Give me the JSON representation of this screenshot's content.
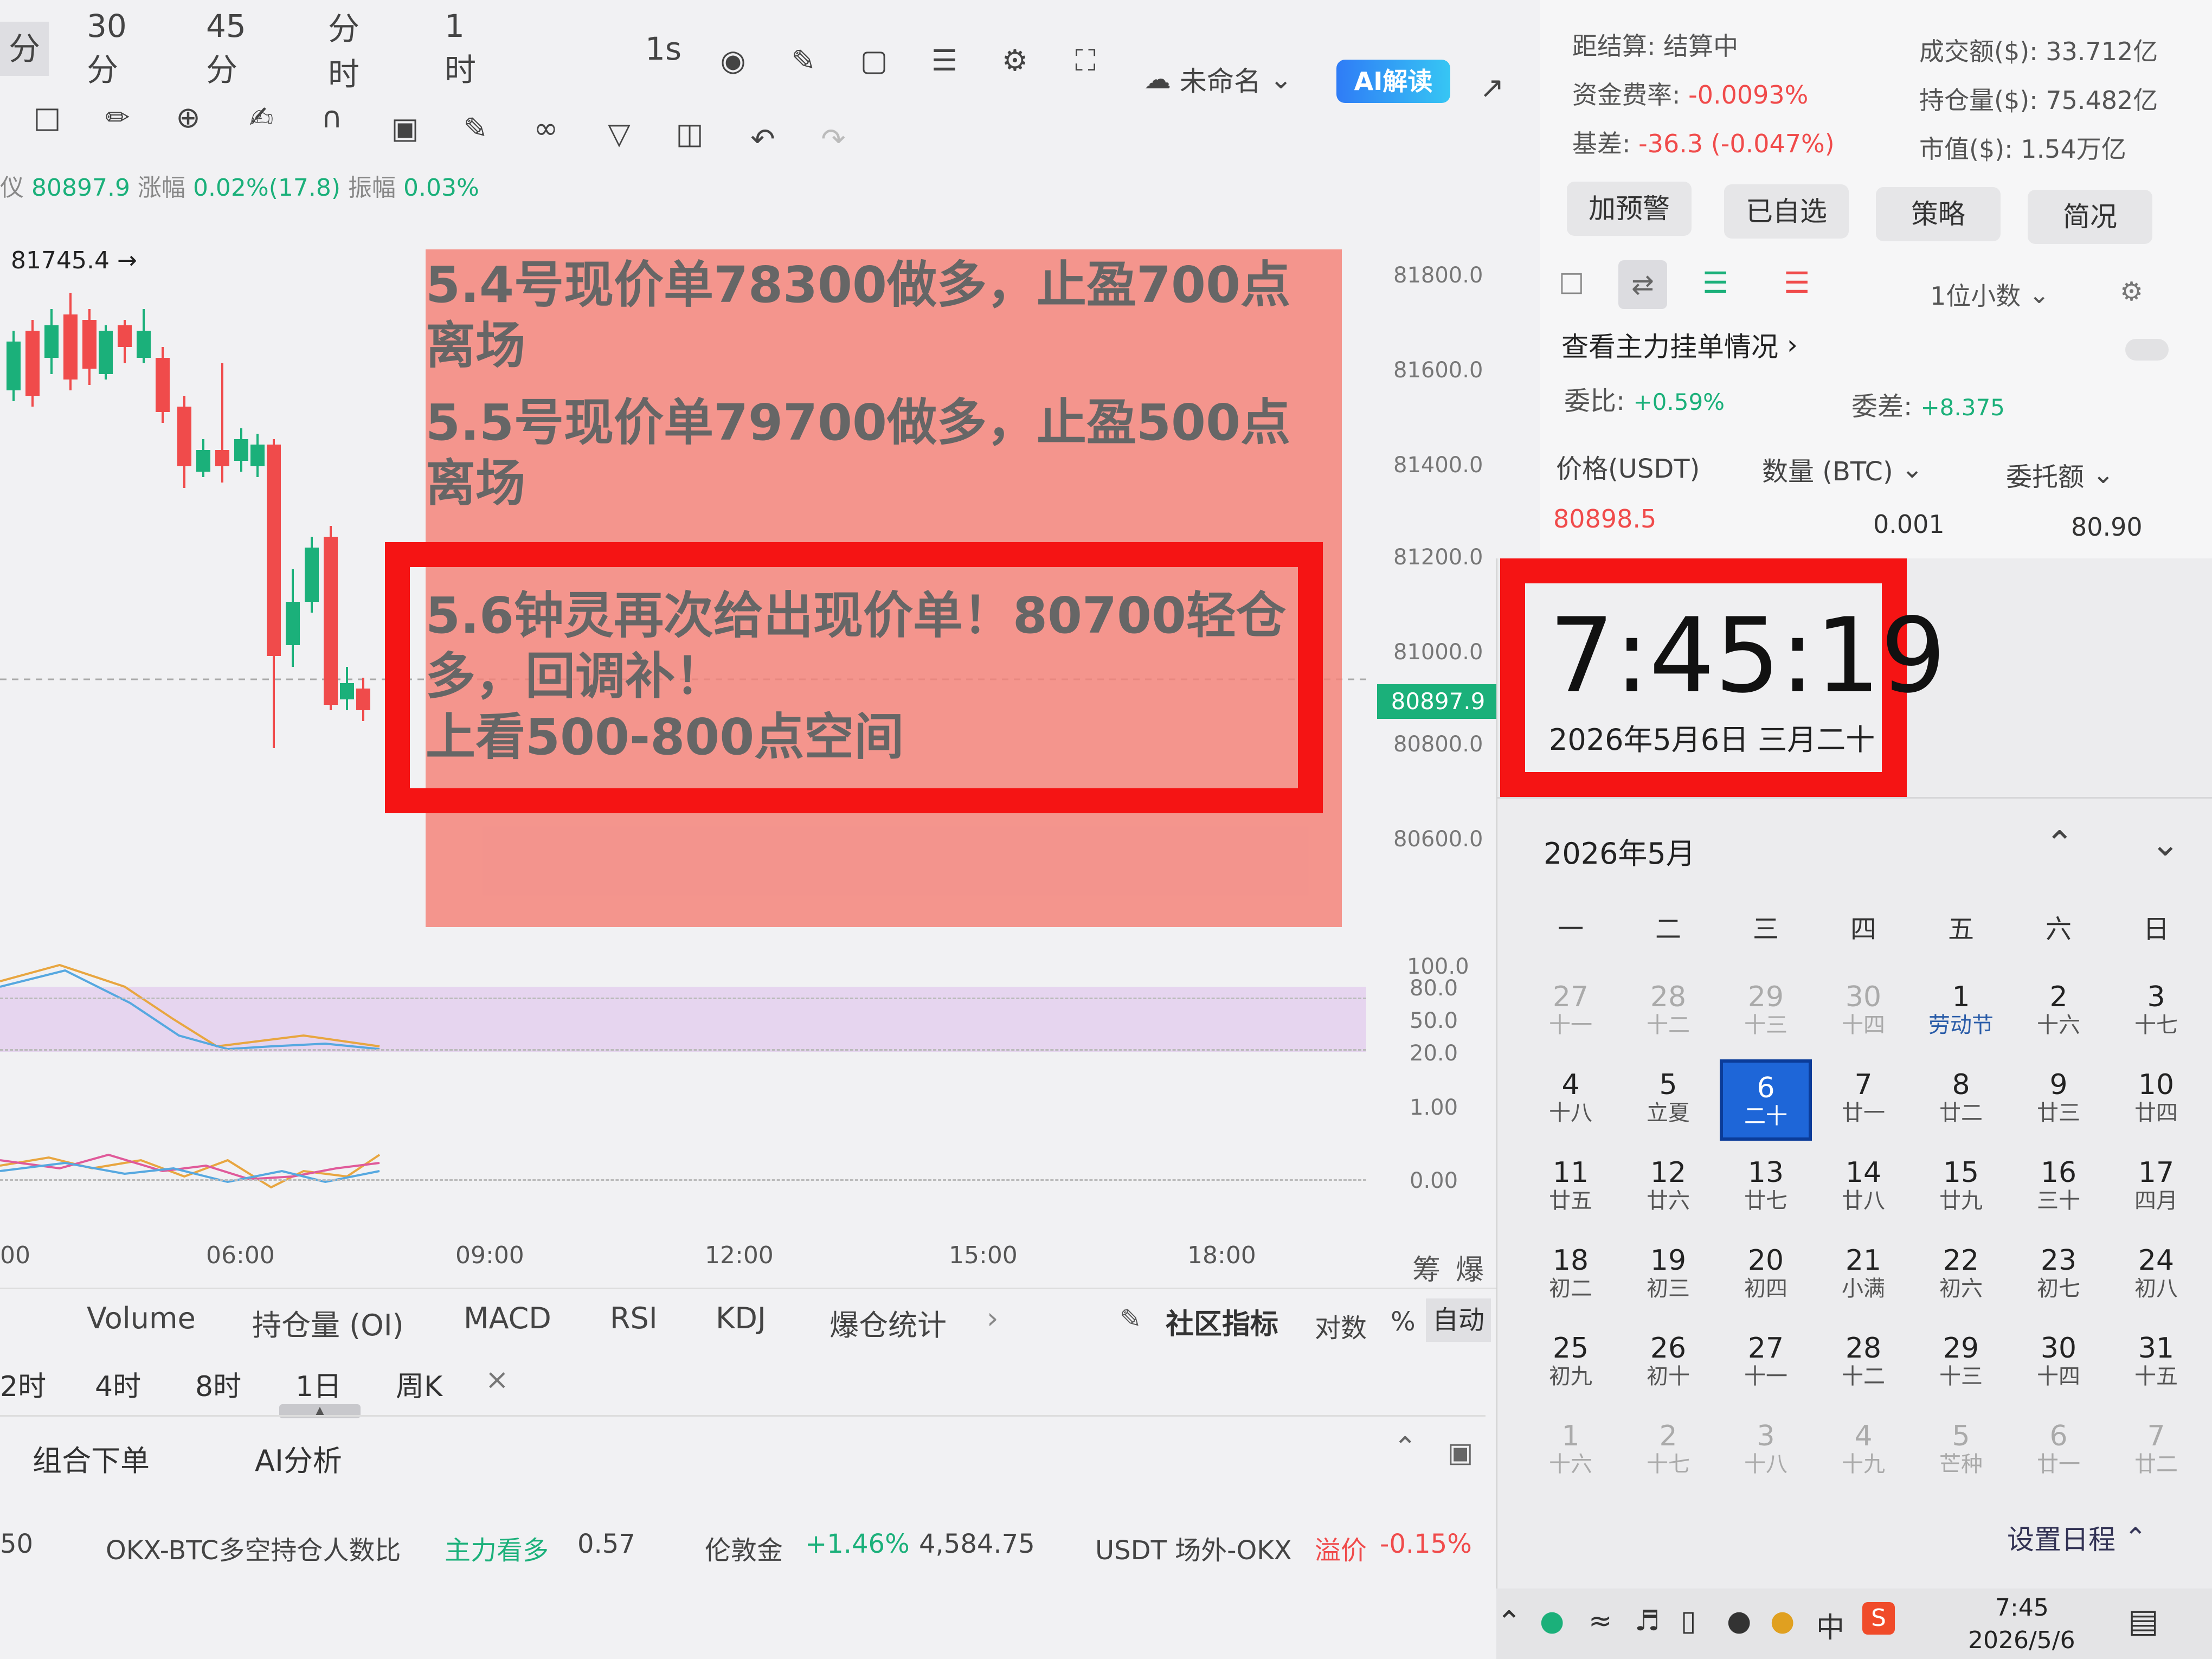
{
  "toolbar": {
    "timeframes": [
      "分",
      "30分",
      "45分",
      "分时",
      "1时",
      "1s"
    ],
    "chart_name": "未命名",
    "ai_button": "AI解读"
  },
  "stats_line": {
    "price_label": "仪",
    "price": "80897.9",
    "change_label": "涨幅",
    "change": "0.02%(17.8)",
    "amplitude_label": "振幅",
    "amplitude": "0.03%"
  },
  "chart": {
    "high_marker": "81745.4 →",
    "current_price": "80897.9",
    "y_ticks": [
      "81800.0",
      "81600.0",
      "81400.0",
      "81200.0",
      "81000.0",
      "80800.0",
      "80600.0"
    ],
    "osc_ticks": [
      "100.0",
      "80.0",
      "50.0",
      "20.0"
    ],
    "macd_ticks": [
      "1.00",
      "0.00"
    ],
    "time_ticks": [
      "00",
      "06:00",
      "09:00",
      "12:00",
      "15:00",
      "18:00"
    ],
    "right_tags": [
      "筹",
      "爆"
    ]
  },
  "annotation": {
    "line1": "5.4号现价单78300做多，止盈700点",
    "line1b": "离场",
    "line2": "5.5号现价单79700做多，止盈500点",
    "line2b": "离场",
    "line3": "5.6钟灵再次给出现价单！80700轻仓",
    "line3b": "多，回调补！",
    "line4": "上看500-800点空间"
  },
  "indicator_tabs": [
    "Volume",
    "持仓量 (OI)",
    "MACD",
    "RSI",
    "KDJ",
    "爆仓统计"
  ],
  "indicator_right": {
    "community": "社区指标",
    "log": "对数",
    "pct": "%",
    "auto": "自动"
  },
  "periods": [
    "2时",
    "4时",
    "8时",
    "1日",
    "周K",
    "×"
  ],
  "bottom_tabs": [
    "组合下单",
    "AI分析"
  ],
  "ticker": {
    "lead": "50",
    "item1_name": "OKX-BTC多空持仓人数比",
    "item1_tag": "主力看多",
    "item1_val": "0.57",
    "item2_name": "伦敦金",
    "item2_chg": "+1.46%",
    "item2_val": "4,584.75",
    "item3_name": "USDT 场外-OKX",
    "item3_tag": "溢价",
    "item3_val": "-0.15%"
  },
  "right_panel": {
    "settle_label": "距结算:",
    "settle_value": "结算中",
    "funding_label": "资金费率:",
    "funding_value": "-0.0093%",
    "basis_label": "基差:",
    "basis_value": "-36.3 (-0.047%)",
    "volume_label": "成交额($):",
    "volume_value": "33.712亿",
    "oi_label": "持仓量($):",
    "oi_value": "75.482亿",
    "mcap_label": "市值($):",
    "mcap_value": "1.54万亿",
    "buttons": [
      "加预警",
      "已自选",
      "策略",
      "简况"
    ],
    "decimals": "1位小数",
    "orders_link": "查看主力挂单情况",
    "ratio_label": "委比:",
    "ratio_value": "+0.59%",
    "diff_label": "委差:",
    "diff_value": "+8.375",
    "col_price": "价格(USDT)",
    "col_qty": "数量 (BTC)",
    "col_amount": "委托额",
    "row_price": "80898.5",
    "row_qty": "0.001",
    "row_amount": "80.90"
  },
  "clock": {
    "time": "7:45:19",
    "date": "2026年5月6日 三月二十",
    "month": "2026年5月",
    "weekdays": [
      "一",
      "二",
      "三",
      "四",
      "五",
      "六",
      "日"
    ],
    "days": [
      [
        "27",
        "十一"
      ],
      [
        "28",
        "十二"
      ],
      [
        "29",
        "十三"
      ],
      [
        "30",
        "十四"
      ],
      [
        "1",
        "劳动节"
      ],
      [
        "2",
        "十六"
      ],
      [
        "3",
        "十七"
      ],
      [
        "4",
        "十八"
      ],
      [
        "5",
        "立夏"
      ],
      [
        "6",
        "二十"
      ],
      [
        "7",
        "廿一"
      ],
      [
        "8",
        "廿二"
      ],
      [
        "9",
        "廿三"
      ],
      [
        "10",
        "廿四"
      ],
      [
        "11",
        "廿五"
      ],
      [
        "12",
        "廿六"
      ],
      [
        "13",
        "廿七"
      ],
      [
        "14",
        "廿八"
      ],
      [
        "15",
        "廿九"
      ],
      [
        "16",
        "三十"
      ],
      [
        "17",
        "四月"
      ],
      [
        "18",
        "初二"
      ],
      [
        "19",
        "初三"
      ],
      [
        "20",
        "初四"
      ],
      [
        "21",
        "小满"
      ],
      [
        "22",
        "初六"
      ],
      [
        "23",
        "初七"
      ],
      [
        "24",
        "初八"
      ],
      [
        "25",
        "初九"
      ],
      [
        "26",
        "初十"
      ],
      [
        "27",
        "十一"
      ],
      [
        "28",
        "十二"
      ],
      [
        "29",
        "十三"
      ],
      [
        "30",
        "十四"
      ],
      [
        "31",
        "十五"
      ],
      [
        "1",
        "十六"
      ],
      [
        "2",
        "十七"
      ],
      [
        "3",
        "十八"
      ],
      [
        "4",
        "十九"
      ],
      [
        "5",
        "芒种"
      ],
      [
        "6",
        "廿一"
      ],
      [
        "7",
        "廿二"
      ]
    ],
    "schedule": "设置日程"
  },
  "taskbar": {
    "time": "7:45",
    "date": "2026/5/6",
    "ime": "中"
  }
}
